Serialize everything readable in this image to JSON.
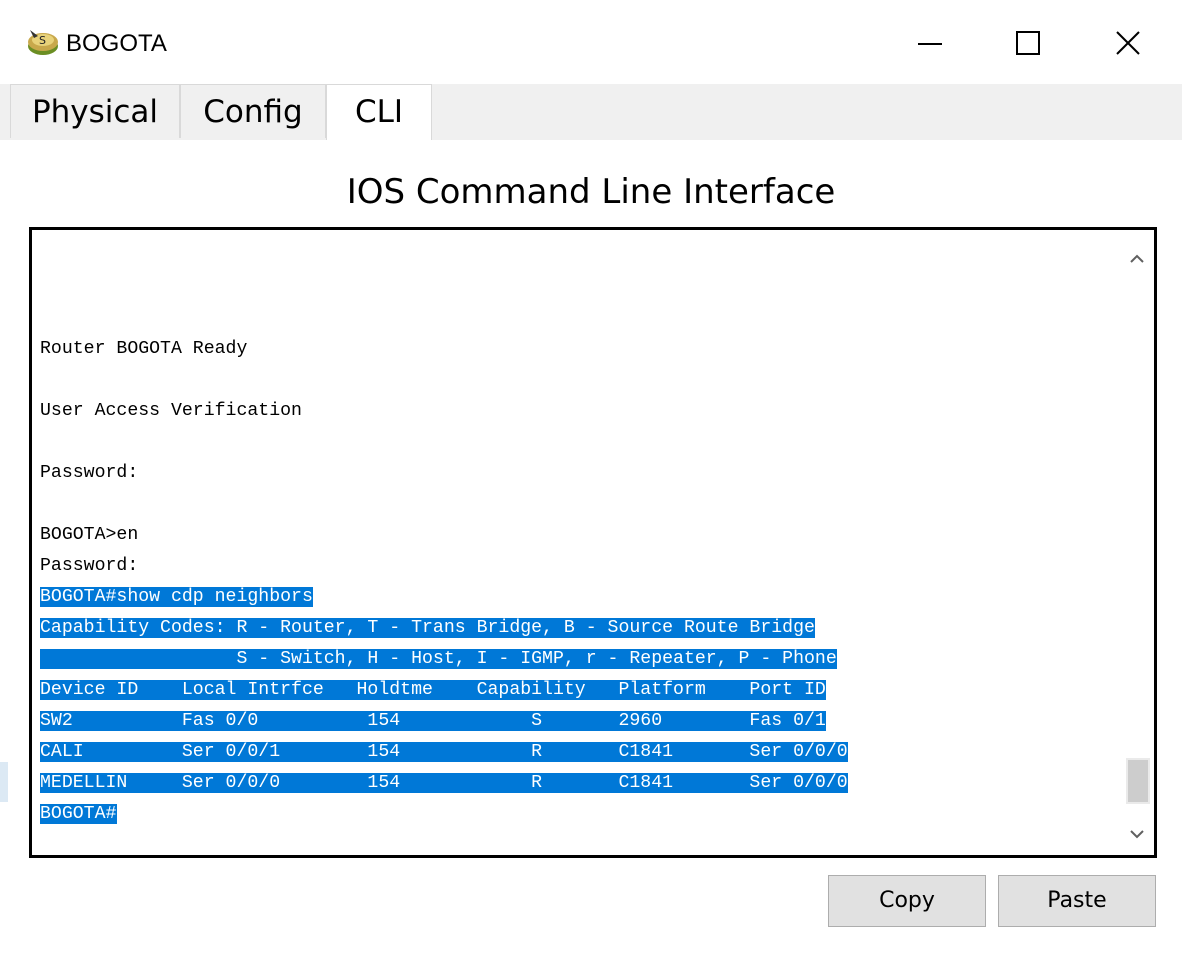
{
  "window": {
    "title": "BOGOTA",
    "icon": "router-device-icon",
    "controls": [
      "minimize",
      "maximize",
      "close"
    ]
  },
  "tabs": [
    {
      "label": "Physical",
      "active": false
    },
    {
      "label": "Config",
      "active": false
    },
    {
      "label": "CLI",
      "active": true
    }
  ],
  "heading": "IOS Command Line Interface",
  "terminal": {
    "lines": [
      {
        "text": "Router BOGOTA Ready",
        "highlight": false
      },
      {
        "text": "",
        "highlight": false
      },
      {
        "text": "User Access Verification",
        "highlight": false
      },
      {
        "text": "",
        "highlight": false
      },
      {
        "text": "Password:",
        "highlight": false
      },
      {
        "text": "",
        "highlight": false
      },
      {
        "text": "BOGOTA>en",
        "highlight": false
      },
      {
        "text": "Password:",
        "highlight": false
      },
      {
        "text": "BOGOTA#show cdp neighbors",
        "highlight": true
      },
      {
        "text": "Capability Codes: R - Router, T - Trans Bridge, B - Source Route Bridge",
        "highlight": true
      },
      {
        "text": "                  S - Switch, H - Host, I - IGMP, r - Repeater, P - Phone",
        "highlight": true
      },
      {
        "text": "Device ID    Local Intrfce   Holdtme    Capability   Platform    Port ID",
        "highlight": true
      },
      {
        "text": "SW2          Fas 0/0          154            S       2960        Fas 0/1",
        "highlight": true
      },
      {
        "text": "CALI         Ser 0/0/1        154            R       C1841       Ser 0/0/0",
        "highlight": true
      },
      {
        "text": "MEDELLIN     Ser 0/0/0        154            R       C1841       Ser 0/0/0",
        "highlight": true
      },
      {
        "text": "BOGOTA#",
        "highlight": true,
        "cursor": true
      }
    ]
  },
  "buttons": {
    "copy": "Copy",
    "paste": "Paste"
  },
  "colors": {
    "selection": "#0078d7",
    "tab_bg": "#f0f0f0",
    "button_bg": "#e1e1e1"
  }
}
